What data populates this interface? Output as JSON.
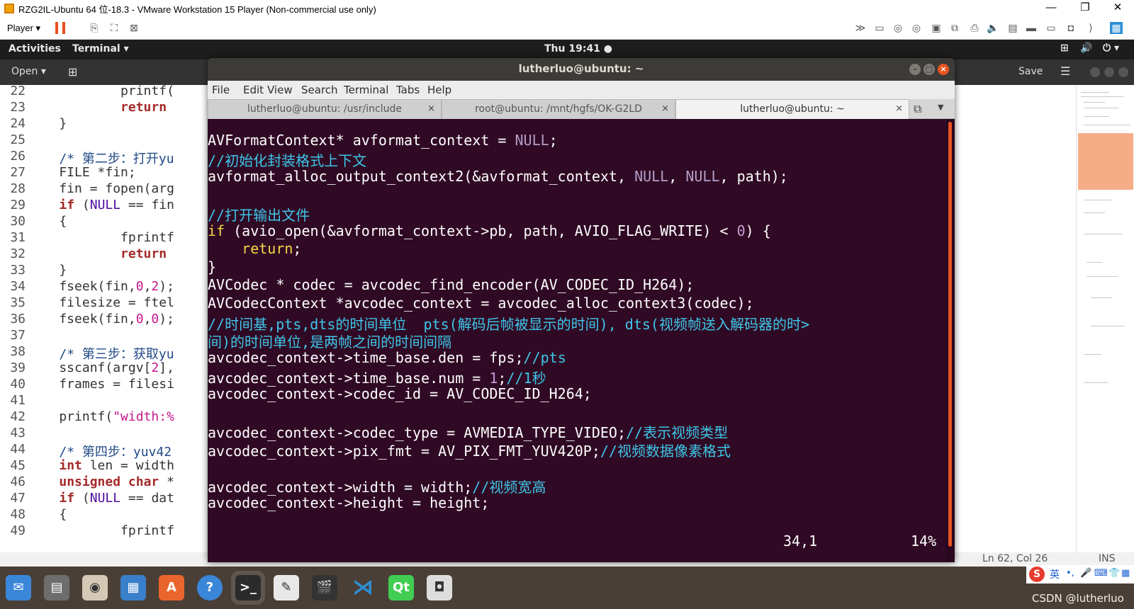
{
  "vmware": {
    "title": "RZG2IL-Ubuntu 64 位-18.3 - VMware Workstation 15 Player (Non-commercial use only)",
    "player_menu": "Player ▾",
    "win_min": "—",
    "win_max": "❐",
    "win_close": "✕"
  },
  "gnome": {
    "activities": "Activities",
    "app_menu": "Terminal ▾",
    "clock": "Thu 19:41 ●",
    "tray_network": "⊞",
    "tray_volume": "🔊",
    "tray_power": "⏻ ▾"
  },
  "gedit": {
    "open": "Open ▾",
    "save": "Save",
    "menu": "☰",
    "status_pos": "Ln 62, Col 26",
    "status_ins": "INS",
    "lines": [
      {
        "n": "22",
        "code": "            printf("
      },
      {
        "n": "23",
        "code": "            return"
      },
      {
        "n": "24",
        "code": "    }"
      },
      {
        "n": "25",
        "code": ""
      },
      {
        "n": "26",
        "code": "    /* 第二步：打开yu"
      },
      {
        "n": "27",
        "code": "    FILE *fin;"
      },
      {
        "n": "28",
        "code": "    fin = fopen(arg"
      },
      {
        "n": "29",
        "code": "    if (NULL == fin"
      },
      {
        "n": "30",
        "code": "    {"
      },
      {
        "n": "31",
        "code": "            fprintf"
      },
      {
        "n": "32",
        "code": "            return"
      },
      {
        "n": "33",
        "code": "    }"
      },
      {
        "n": "34",
        "code": "    fseek(fin,0,2);"
      },
      {
        "n": "35",
        "code": "    filesize = ftel"
      },
      {
        "n": "36",
        "code": "    fseek(fin,0,0);"
      },
      {
        "n": "37",
        "code": ""
      },
      {
        "n": "38",
        "code": "    /* 第三步：获取yu"
      },
      {
        "n": "39",
        "code": "    sscanf(argv[2],"
      },
      {
        "n": "40",
        "code": "    frames = filesi"
      },
      {
        "n": "41",
        "code": ""
      },
      {
        "n": "42",
        "code": "    printf(\"width:%"
      },
      {
        "n": "43",
        "code": ""
      },
      {
        "n": "44",
        "code": "    /* 第四步：yuv42"
      },
      {
        "n": "45",
        "code": "    int len = width"
      },
      {
        "n": "46",
        "code": "    unsigned char *"
      },
      {
        "n": "47",
        "code": "    if (NULL == dat"
      },
      {
        "n": "48",
        "code": "    {"
      },
      {
        "n": "49",
        "code": "            fprintf"
      }
    ]
  },
  "terminal": {
    "title": "lutherluo@ubuntu: ~",
    "menu": [
      "File",
      "Edit",
      "View",
      "Search",
      "Terminal",
      "Tabs",
      "Help"
    ],
    "tabs": [
      {
        "label": "lutherluo@ubuntu: /usr/include",
        "close": "×"
      },
      {
        "label": "root@ubuntu: /mnt/hgfs/OK-G2LD",
        "close": "×"
      },
      {
        "label": "lutherluo@ubuntu: ~",
        "close": "×"
      }
    ],
    "new_tab": "⧉",
    "tab_dropdown": "▼",
    "lines": [
      {
        "a": "",
        "b": "",
        "c": ""
      },
      {
        "a": "AVFormatContext* avformat_context = ",
        "b": "NULL",
        "c": ";"
      },
      {
        "cm": "//初始化封装格式上下文"
      },
      {
        "a": "avformat_alloc_output_context2(&avformat_context, ",
        "b": "NULL",
        "c": ", ",
        "d": "NULL",
        "e": ", path);"
      },
      {
        "a": ""
      },
      {
        "cm": "//打开输出文件"
      },
      {
        "kw": "if",
        "a": " (avio_open(&avformat_context->pb, path, AVIO_FLAG_WRITE) < ",
        "num": "0",
        "c": ") {"
      },
      {
        "a": "    ",
        "kw2": "return",
        "c": ";"
      },
      {
        "a": "}"
      },
      {
        "a": "AVCodec * codec = avcodec_find_encoder(AV_CODEC_ID_H264);"
      },
      {
        "a": "AVCodecContext *avcodec_context = avcodec_alloc_context3(codec);"
      },
      {
        "cm": "//时间基,pts,dts的时间单位  pts(解码后帧被显示的时间), dts(视频帧送入解码器的时>"
      },
      {
        "cm": "间)的时间单位,是两帧之间的时间间隔"
      },
      {
        "a": "avcodec_context->time_base.den = fps;",
        "cm2": "//pts"
      },
      {
        "a": "avcodec_context->time_base.num = ",
        "num": "1",
        "c": ";",
        "cm2": "//1秒"
      },
      {
        "a": "avcodec_context->codec_id = AV_CODEC_ID_H264;"
      },
      {
        "a": ""
      },
      {
        "a": "avcodec_context->codec_type = AVMEDIA_TYPE_VIDEO;",
        "cm2": "//表示视频类型"
      },
      {
        "a": "avcodec_context->pix_fmt = AV_PIX_FMT_YUV420P;",
        "cm2": "//视频数据像素格式"
      },
      {
        "a": ""
      },
      {
        "a": "avcodec_context->width = width;",
        "cm2": "//视频宽高"
      },
      {
        "a": "avcodec_context->height = height;"
      }
    ],
    "cursor_pos": "34,1",
    "scroll_pct": "14%"
  },
  "ime": {
    "logo": "S",
    "mode": "英"
  },
  "watermark": "CSDN @lutherluo",
  "colors": {
    "terminal_bg": "#300a24",
    "comment": "#3fc6e8",
    "keyword": "#f5d547",
    "null": "#b39ec8",
    "accent": "#e95420"
  }
}
